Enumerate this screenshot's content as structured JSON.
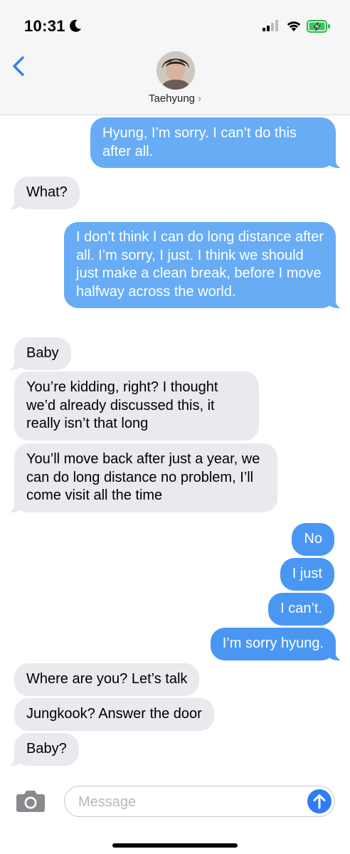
{
  "status": {
    "time": "10:31"
  },
  "header": {
    "contact_name": "Taehyung",
    "contact_chevron": "›"
  },
  "messages": [
    {
      "side": "out",
      "text": "Hyung, I’m sorry. I can’t do this after all."
    },
    {
      "side": "in",
      "text": "What?"
    },
    {
      "side": "out",
      "text": "I don’t think I can do long distance after all. I’m sorry, I just. I think we should just make a clean break, before I move halfway across the world."
    },
    {
      "side": "in",
      "text": "Baby"
    },
    {
      "side": "in",
      "text": "You’re kidding, right? I thought we’d already discussed this, it really isn’t that long"
    },
    {
      "side": "in",
      "text": "You’ll move back after just a year, we can do long distance no problem, I’ll come visit all the time"
    },
    {
      "side": "out",
      "text": "No"
    },
    {
      "side": "out",
      "text": "I just"
    },
    {
      "side": "out",
      "text": "I can’t."
    },
    {
      "side": "out",
      "text": "I’m sorry hyung."
    },
    {
      "side": "in",
      "text": "Where are you? Let’s talk"
    },
    {
      "side": "in",
      "text": "Jungkook? Answer the door"
    },
    {
      "side": "in",
      "text": "Baby?"
    }
  ],
  "composer": {
    "placeholder": "Message"
  },
  "colors": {
    "outgoing_bubble": "#4a97f3",
    "incoming_bubble": "#e9e9ee",
    "send_button": "#2f7cf6",
    "back_chevron": "#2f7cf6"
  }
}
